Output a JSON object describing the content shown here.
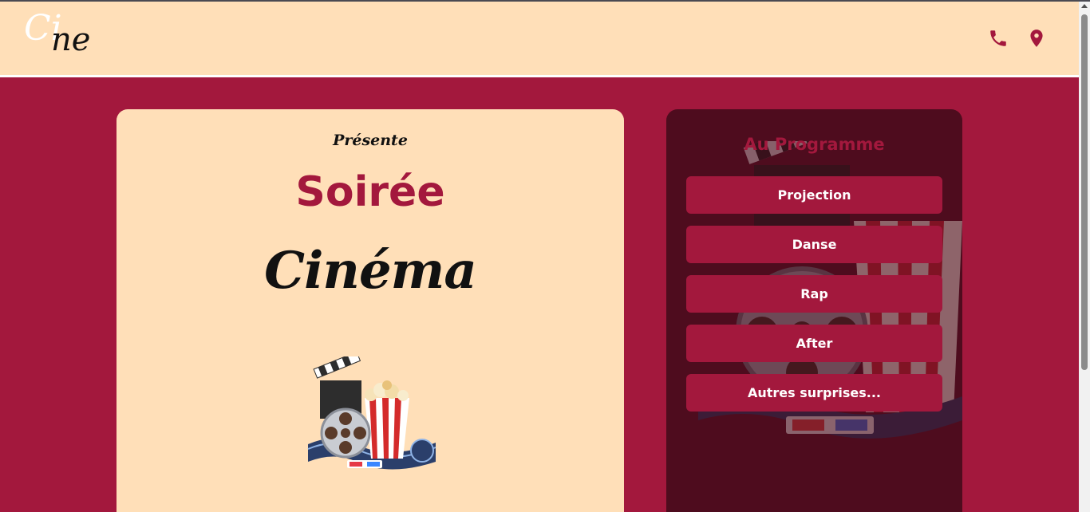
{
  "header": {
    "logo": {
      "part1": "Ci",
      "part2": "ne"
    },
    "icons": [
      "phone-icon",
      "location-pin-icon"
    ]
  },
  "hero": {
    "presente": "Présente",
    "title": "Soirée",
    "subtitle": "Cinéma",
    "illustration": "cinema-illustration"
  },
  "programme": {
    "title": "Au Programme",
    "items": [
      "Projection",
      "Danse",
      "Rap",
      "After",
      "Autres surprises..."
    ]
  },
  "colors": {
    "brand": "#a3183d",
    "cream": "#ffdfb8",
    "dark_panel": "#4e0c1e"
  }
}
